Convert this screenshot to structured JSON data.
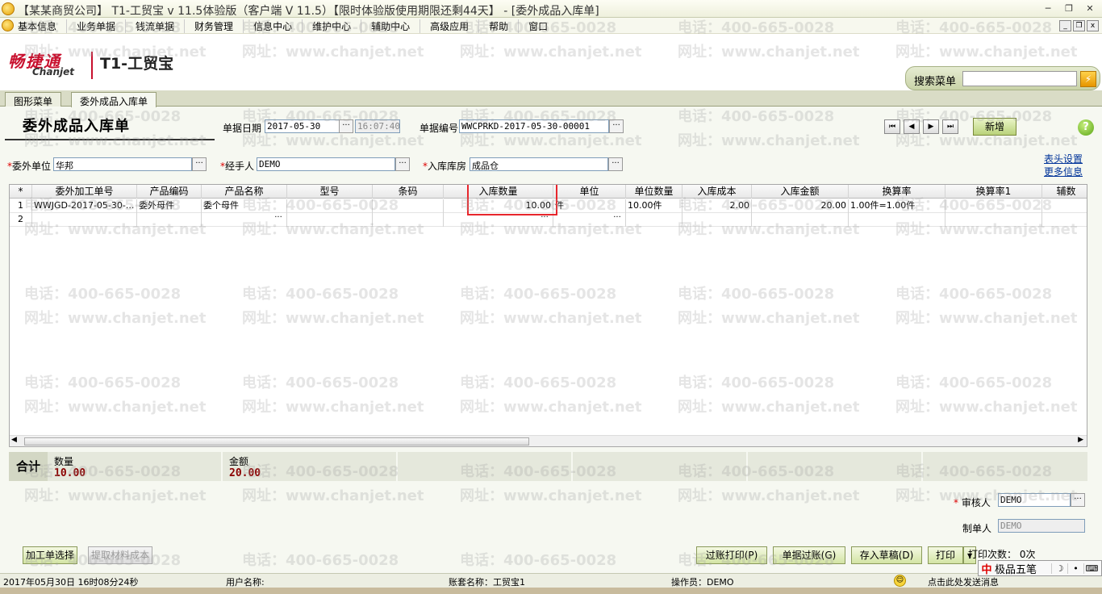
{
  "window": {
    "title": "【某某商贸公司】 T1-工贸宝 v 11.5体验版（客户端 V 11.5）【限时体验版使用期限还剩44天】 - [委外成品入库单]",
    "controls": [
      "─",
      "❐",
      "✕"
    ]
  },
  "menubar": {
    "items": [
      "基本信息",
      "业务单据",
      "钱流单据",
      "财务管理",
      "信息中心",
      "维护中心",
      "辅助中心",
      "高级应用",
      "帮助",
      "窗口"
    ],
    "mdi_controls": [
      "_",
      "❐",
      "x"
    ]
  },
  "banner": {
    "logo_cn": "畅捷通",
    "logo_en": "Chanjet",
    "product": "T1-工贸宝",
    "search_label": "搜索菜单",
    "search_value": ""
  },
  "tabs": [
    "图形菜单",
    "委外成品入库单"
  ],
  "form": {
    "title": "委外成品入库单",
    "date_label": "单据日期",
    "date_value": "2017-05-30",
    "time_value": "16:07:40",
    "docno_label": "单据编号",
    "docno_value": "WWCPRKD-2017-05-30-00001",
    "new_button": "新增",
    "supplier_label": "委外单位",
    "supplier_value": "华邦",
    "handler_label": "经手人",
    "handler_value": "DEMO",
    "warehouse_label": "入库库房",
    "warehouse_value": "成品仓",
    "required_mark": "*",
    "link_header_settings": "表头设置",
    "link_more_info": "更多信息"
  },
  "grid": {
    "columns": [
      "*",
      "委外加工单号",
      "产品编码",
      "产品名称",
      "型号",
      "条码",
      "入库数量",
      "单位",
      "单位数量",
      "入库成本",
      "入库金额",
      "换算率",
      "换算率1",
      "辅数"
    ],
    "rows": [
      [
        "1",
        "WWJGD-2017-05-30-...",
        "委外母件",
        "委个母件",
        "",
        "",
        "10.00",
        "件",
        "10.00件",
        "2.00",
        "20.00",
        "1.00件=1.00件",
        "",
        ""
      ],
      [
        "2",
        "",
        "",
        "",
        "",
        "",
        "",
        "",
        "",
        "",
        "",
        "",
        "",
        ""
      ]
    ],
    "ellipsis": "···"
  },
  "totals": {
    "label": "合计",
    "qty_label": "数量",
    "qty_value": "10.00",
    "amount_label": "金额",
    "amount_value": "20.00"
  },
  "footer": {
    "auditor_label": "审核人",
    "auditor_value": "DEMO",
    "maker_label": "制单人",
    "maker_value": "DEMO",
    "btn_select_order": "加工单选择",
    "btn_extract_cost": "提取材料成本",
    "btn_post_print": "过账打印(P)",
    "btn_post": "单据过账(G)",
    "btn_draft": "存入草稿(D)",
    "btn_print": "打印",
    "print_count_label": "打印次数：",
    "print_count_value": "0次"
  },
  "statusbar": {
    "datetime": "2017年05月30日  16时08分24秒",
    "user_label": "用户名称:",
    "account_label": "账套名称：工贸宝1",
    "operator_label": "操作员：DEMO",
    "message": "点击此处发送消息"
  },
  "ime": {
    "logo": "中",
    "name": "极品五笔",
    "keys": [
      "☽",
      "•",
      "⌨"
    ]
  },
  "watermark": {
    "phone": "电话：400-665-0028",
    "site": "网址：www.chanjet.net"
  },
  "colors": {
    "accent_red": "#e8262c",
    "brand_red": "#c8102e",
    "total_value": "#8b0000"
  }
}
